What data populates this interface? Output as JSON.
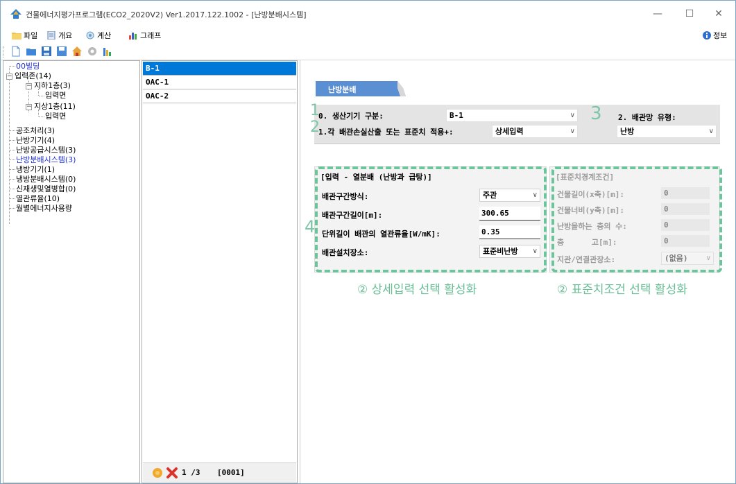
{
  "window": {
    "title": "건물에너지평가프로그램(ECO2_2020V2) Ver1.2017.122.1002 - [난방분배시스템]",
    "controls": {
      "minimize": "—",
      "maximize": "☐",
      "close": "✕"
    }
  },
  "menu": {
    "items": [
      {
        "label": "파일",
        "icon": "folder-icon"
      },
      {
        "label": "개요",
        "icon": "document-icon"
      },
      {
        "label": "계산",
        "icon": "calculate-icon"
      },
      {
        "label": "그래프",
        "icon": "chart-icon"
      }
    ],
    "info_label": "정보"
  },
  "toolbar": {
    "buttons": [
      "new-file-icon",
      "open-folder-icon",
      "save-icon",
      "save-as-icon",
      "home-icon",
      "settings-gear-icon",
      "bar-chart-icon"
    ]
  },
  "tree": {
    "items": [
      {
        "label": "00빌딩",
        "blue": true
      },
      {
        "label": "입력존(14)"
      },
      {
        "label": "지하1층(3)"
      },
      {
        "label": "입력면"
      },
      {
        "label": "지상1층(11)"
      },
      {
        "label": "입력면"
      },
      {
        "label": "공조처리(3)"
      },
      {
        "label": "난방기기(4)"
      },
      {
        "label": "난방공급시스템(3)"
      },
      {
        "label": "난방분배시스템(3)",
        "blue": true
      },
      {
        "label": "냉방기기(1)"
      },
      {
        "label": "냉방분배시스템(0)"
      },
      {
        "label": "신재생및열병합(0)"
      },
      {
        "label": "열관류율(10)"
      },
      {
        "label": "월별에너지사용량"
      }
    ]
  },
  "list": {
    "rows": [
      "B-1",
      "OAC-1",
      "OAC-2"
    ],
    "footer": {
      "page": "1 /3",
      "code": "[0001]"
    }
  },
  "main": {
    "tab_label": "난방분배",
    "top_form": {
      "step1": "1",
      "step2": "2",
      "step3": "3",
      "generator_label": "0. 생산기기 구분:",
      "generator_value": "B-1",
      "loss_label": "1.각 배관손실산출 또는 표준치 적용+:",
      "loss_value": "상세입력",
      "pipe_type_label": "2. 배관망 유형:",
      "pipe_type_value": "난방"
    },
    "detail": {
      "step4": "4",
      "title": "[입력 - 열분배 (난방과 급탕)]",
      "method_label": "배관구간방식:",
      "method_value": "주관",
      "length_label": "배관구간길이[m]:",
      "length_value": "300.65",
      "heat_loss_label": "단위길이 배관의 열관류율[W/mK]:",
      "heat_loss_value": "0.35",
      "location_label": "배관설치장소:",
      "location_value": "표준비난방"
    },
    "standard": {
      "title": "[표준치경계조건]",
      "x_label": "건물길이(x축)[m]:",
      "x_value": "0",
      "y_label": "건물너비(y축)[m]:",
      "y_value": "0",
      "floors_label": "난방을하는 층의 수:",
      "floors_value": "0",
      "height_label": "층      고[m]:",
      "height_value": "0",
      "branch_label": "지관/연결관장소:",
      "branch_value": "(없음)"
    },
    "captions": {
      "detail": "② 상세입력 선택 활성화",
      "standard": "② 표준치조건 선택 활성화"
    }
  },
  "colors": {
    "selection": "#0078d7",
    "annotation_green": "#6cc49a",
    "tree_blue": "#1d2fd8",
    "tab_blue": "#5b8fd4"
  }
}
